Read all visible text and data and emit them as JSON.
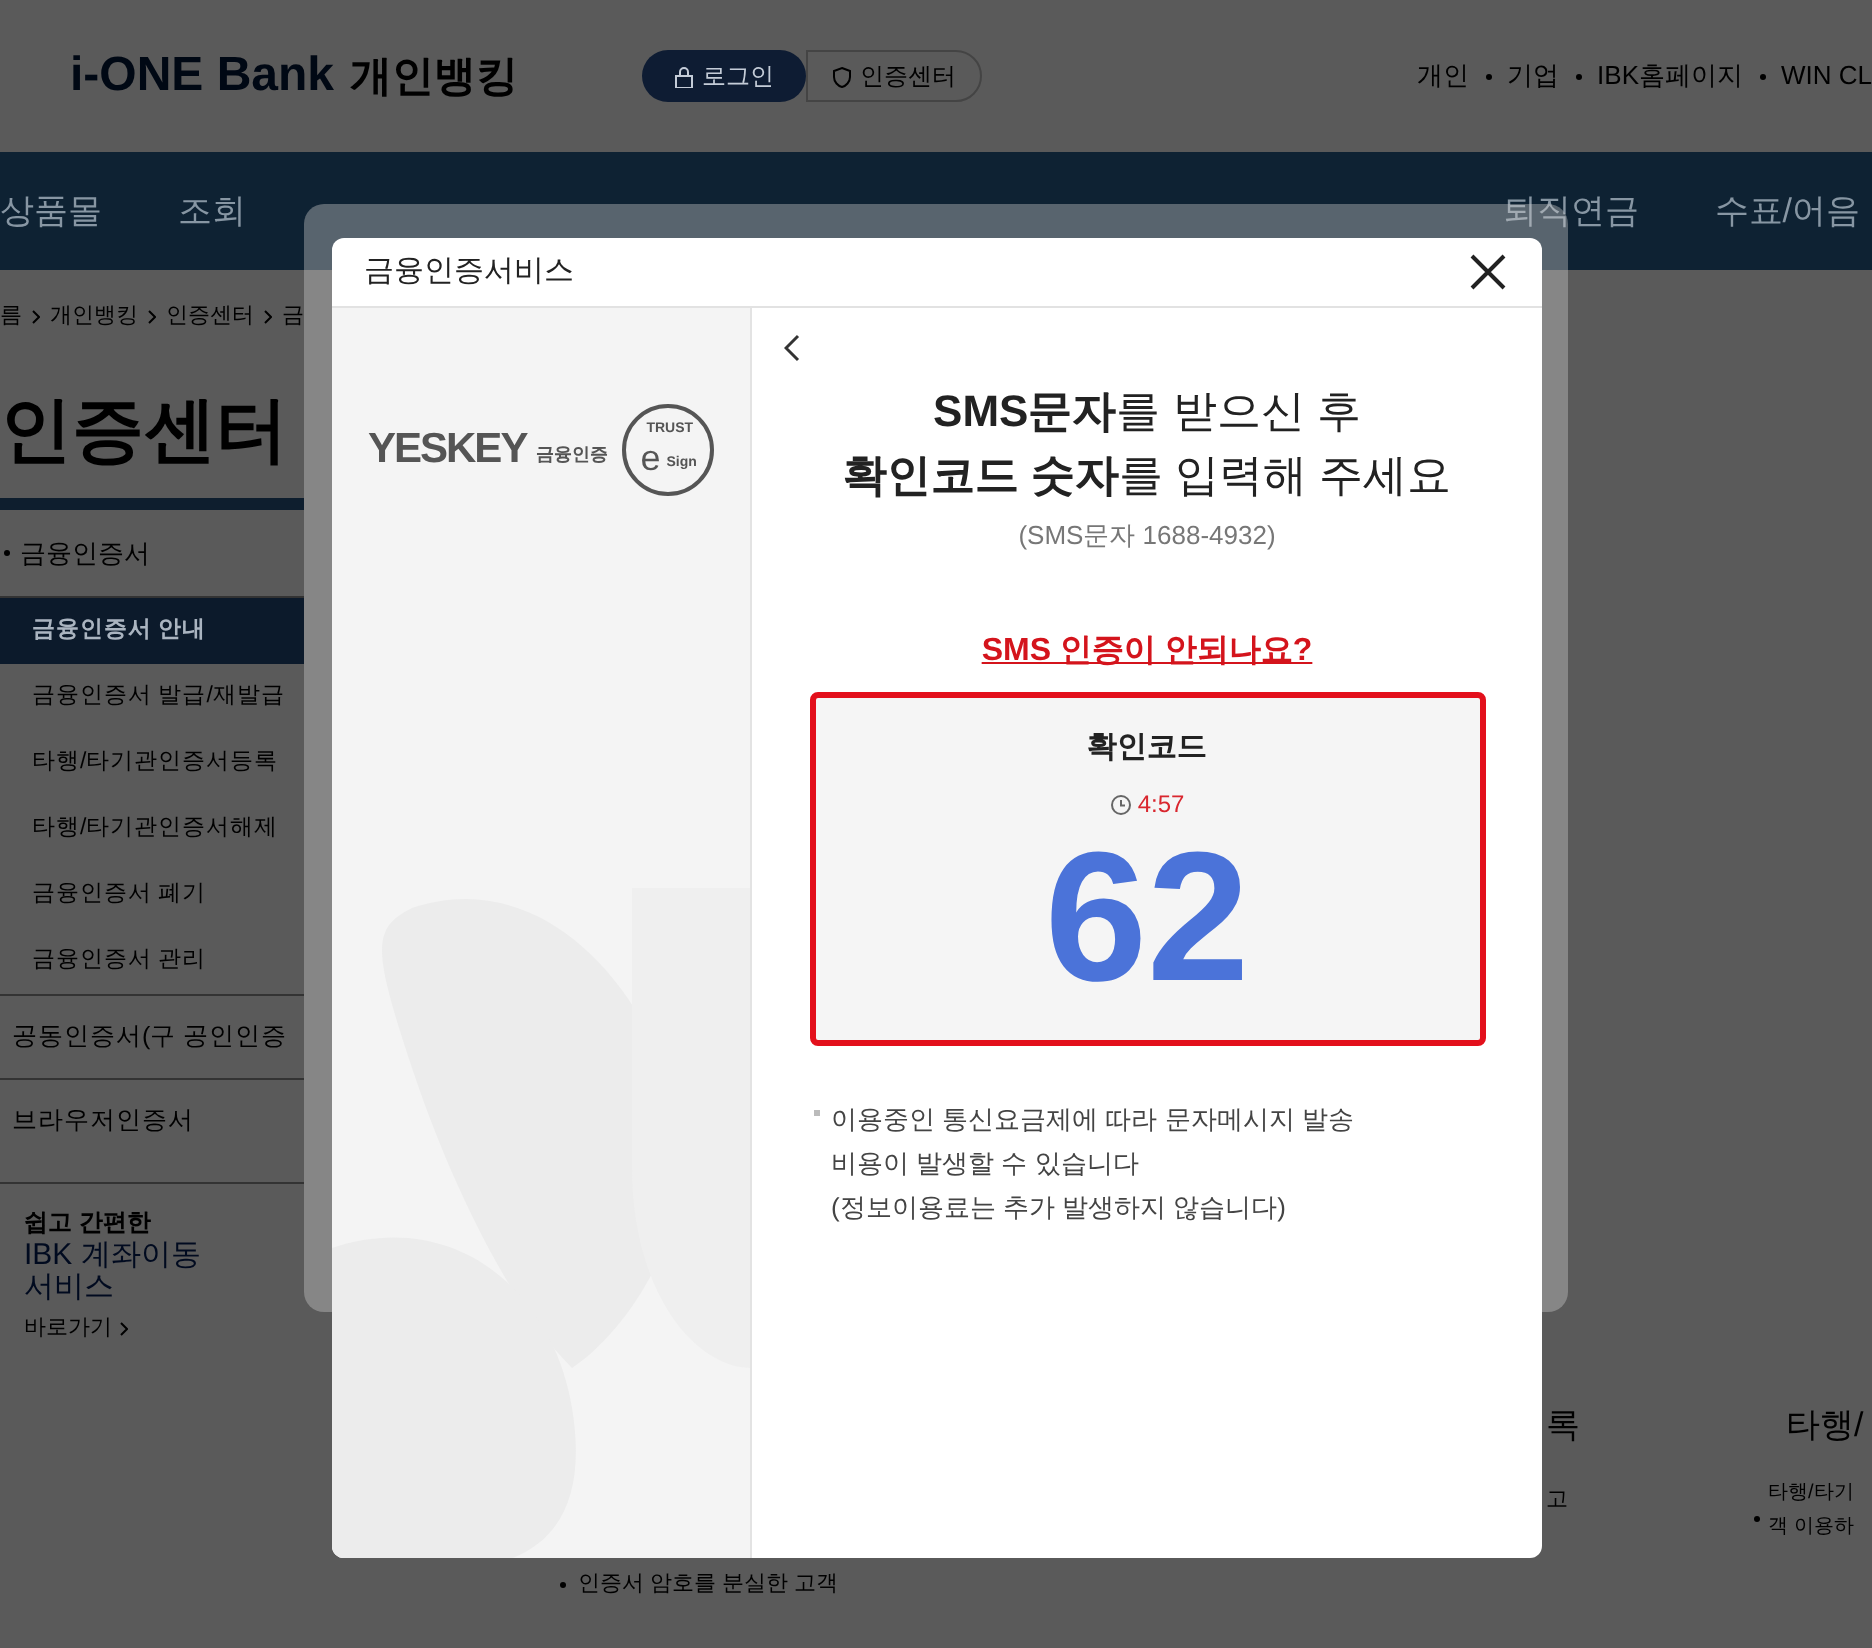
{
  "header": {
    "logo": "i-ONE Bank",
    "logo_sub": "개인뱅킹",
    "login_button": "로그인",
    "cert_button": "인증센터",
    "links": [
      "개인",
      "기업",
      "IBK홈페이지",
      "WIN CL"
    ]
  },
  "nav": {
    "items": [
      "상품몰",
      "조회",
      "퇴직연금",
      "수표/어음"
    ]
  },
  "breadcrumb": [
    "름",
    "개인뱅킹",
    "인증센터",
    "금"
  ],
  "page_title": "인증센터",
  "sidebar": {
    "group": "금융인증서",
    "items": [
      {
        "label": "금융인증서 안내",
        "selected": true
      },
      {
        "label": "금융인증서 발급/재발급",
        "selected": false
      },
      {
        "label": "타행/타기관인증서등록",
        "selected": false
      },
      {
        "label": "타행/타기관인증서해제",
        "selected": false
      },
      {
        "label": "금융인증서 폐기",
        "selected": false
      },
      {
        "label": "금융인증서 관리",
        "selected": false
      }
    ],
    "others": [
      "공동인증서(구 공인인증",
      "브라우저인증서"
    ]
  },
  "banner": {
    "lines": [
      "쉽고 간편한",
      "IBK 계좌이동",
      "서비스"
    ],
    "link": "바로가기"
  },
  "background_fragments": {
    "section_a": "록",
    "section_a_text": "고",
    "section_b": "타행/",
    "section_b_lines": [
      "타행/타기",
      "객 이용하"
    ],
    "bullet_text": "인증서 암호를 분실한 고객"
  },
  "modal": {
    "title": "금융인증서비스",
    "brand": "YESKEY",
    "brand_sub": "금융인증",
    "seal_top": "TRUST",
    "seal_letter": "e",
    "seal_bottom": "Sign",
    "heading_lines": [
      "**SMS문자**를 받으신 후",
      "**확인코드 숫자**를 입력해 주세요"
    ],
    "sms_number": "(SMS문자 1688-4932)",
    "help_link": "SMS 인증이 안되나요?",
    "code_label": "확인코드",
    "timer": "4:57",
    "code": "62",
    "notice_lines": [
      "이용중인 통신요금제에 따라 문자메시지 발송",
      "비용이 발생할 수 있습니다",
      "(정보이용료는 추가 발생하지 않습니다)"
    ]
  }
}
